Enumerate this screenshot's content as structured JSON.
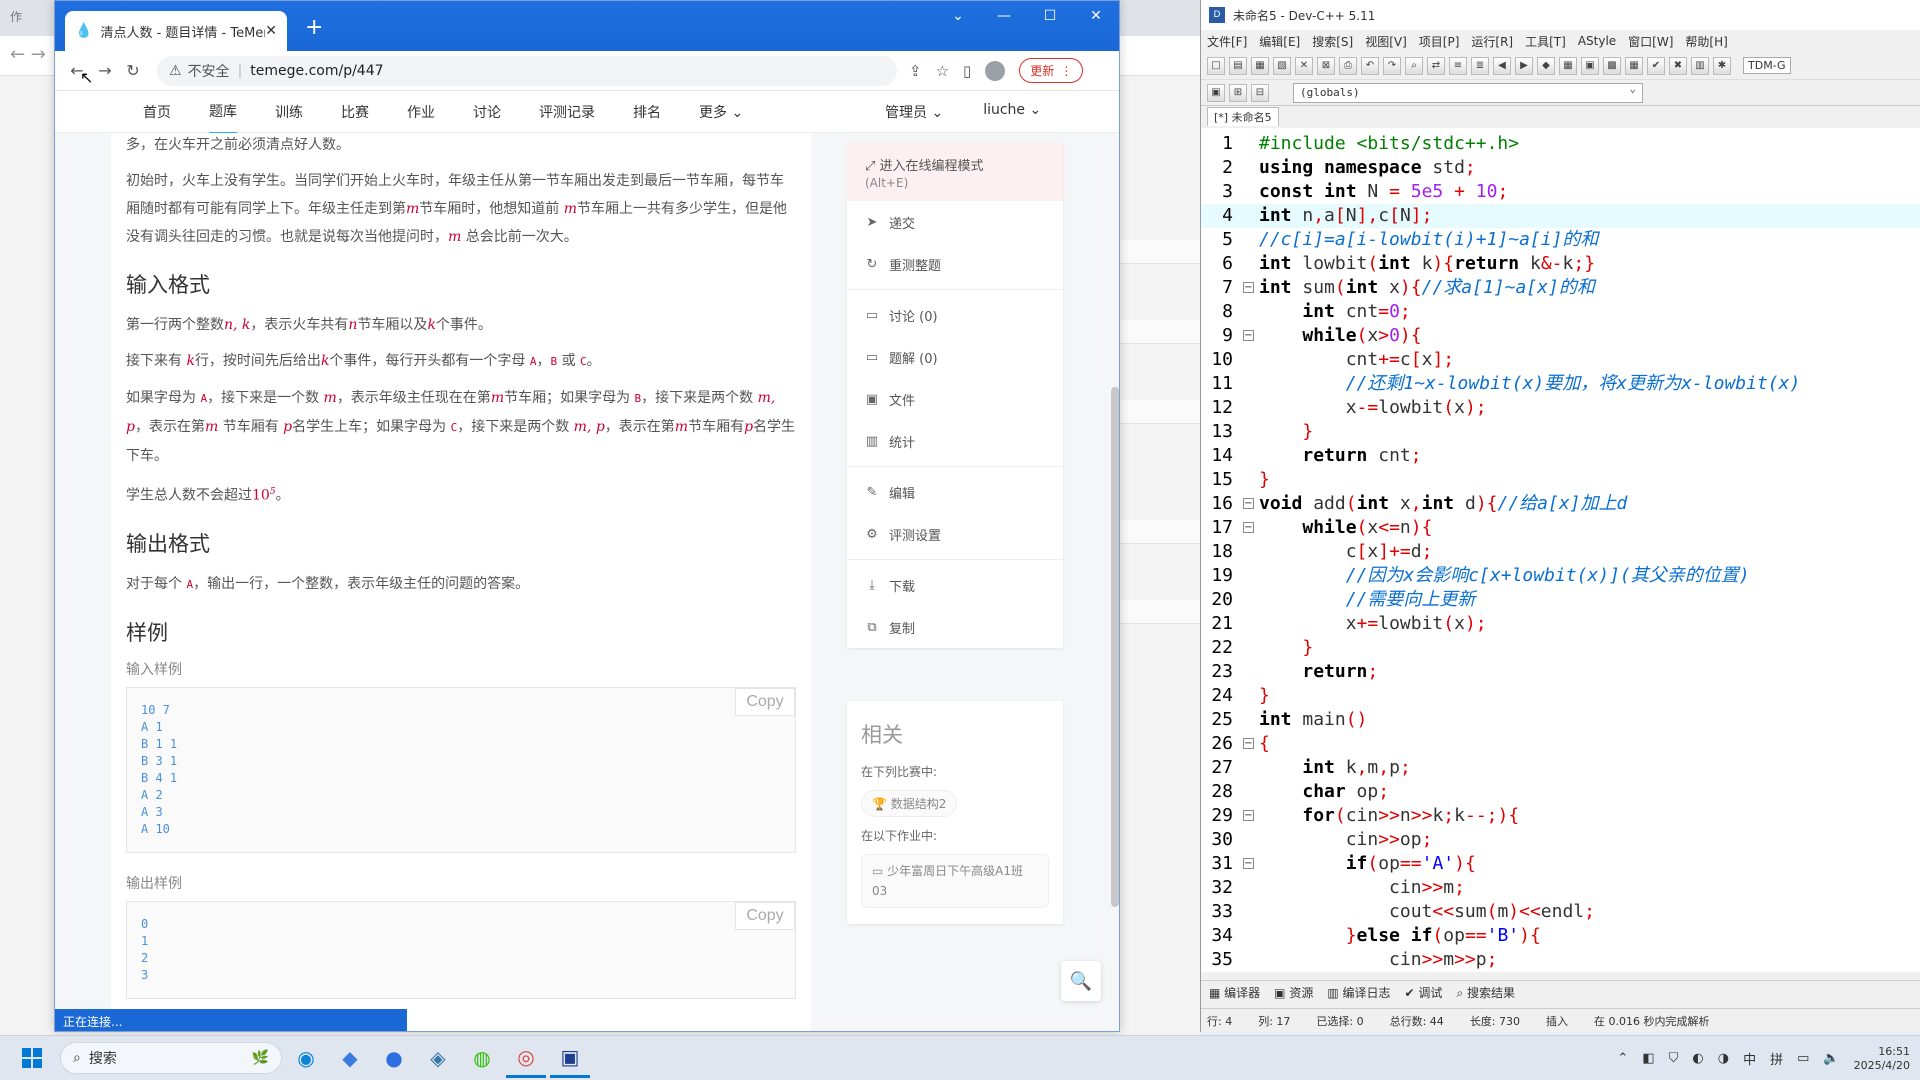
{
  "background": {
    "tab_text": "作",
    "nav_arrows": "← →"
  },
  "browser": {
    "tab_title": "清点人数 - 题目详情 - TeMenHu",
    "address": {
      "insecure_label": "不安全",
      "url": "temege.com/p/447",
      "update_label": "更新"
    },
    "site_nav": {
      "items": [
        "首页",
        "题库",
        "训练",
        "比赛",
        "作业",
        "讨论",
        "评测记录",
        "排名",
        "更多 ⌄"
      ],
      "active_index": 1,
      "admin": "管理员 ⌄",
      "user": "liuche ⌄"
    },
    "content": {
      "intro_partial": "多，在火车开之前必须清点好人数。",
      "para1_a": "初始时，火车上没有学生。当同学们开始上火车时，年级主任从第一节车厢出发走到最后一节车厢，每节车厢随时都有可能有同学上下。年级主任走到第",
      "para1_m1": "m",
      "para1_b": "节车厢时，他想知道前 ",
      "para1_m2": "m",
      "para1_c": "节车厢上一共有多少学生，但是他没有调头往回走的习惯。也就是说每次当他提问时，",
      "para1_m3": "m",
      "para1_d": " 总会比前一次大。",
      "input_heading": "输入格式",
      "in1_a": "第一行两个整数",
      "in1_nk": "n, k",
      "in1_b": "，表示火车共有",
      "in1_n": "n",
      "in1_c": "节车厢以及",
      "in1_k": "k",
      "in1_d": "个事件。",
      "in2_a": "接下来有 ",
      "in2_k": "k",
      "in2_b": "行，按时间先后给出",
      "in2_k2": "k",
      "in2_c": "个事件，每行开头都有一个字母 ",
      "tag_a": "A",
      "in2_sep1": "，",
      "tag_b": "B",
      "in2_or": " 或 ",
      "tag_c": "C",
      "in2_end": "。",
      "in3_a": "如果字母为 ",
      "in3_b": "，接下来是一个数 ",
      "in3_m": "m",
      "in3_c": "，表示年级主任现在在第",
      "in3_m2": "m",
      "in3_d": "节车厢；如果字母为 ",
      "in3_e": "，接下来是两个数 ",
      "in3_mp": "m, p",
      "in3_f": "，表示在第",
      "in3_m3": "m",
      "in3_g": " 节车厢有 ",
      "in3_p": "p",
      "in3_h": "名学生上车；如果字母为 ",
      "in3_i": "，接下来是两个数 ",
      "in3_mp2": "m, p",
      "in3_j": "，表示在第",
      "in3_m4": "m",
      "in3_k": "节车厢有",
      "in3_p2": "p",
      "in3_l": "名学生下车。",
      "in4_a": "学生总人数不会超过",
      "in4_num": "10",
      "in4_exp": "5",
      "in4_end": "。",
      "output_heading": "输出格式",
      "out1_a": "对于每个 ",
      "out1_b": "，输出一行，一个整数，表示年级主任的问题的答案。",
      "sample_heading": "样例",
      "input_sample_label": "输入样例",
      "input_sample": [
        "10 7",
        "A 1",
        "B 1 1",
        "B 3 1",
        "B 4 1",
        "A 2",
        "A 3",
        "A 10"
      ],
      "output_sample_label": "输出样例",
      "output_sample": [
        "0",
        "1",
        "2",
        "3"
      ],
      "copy_label": "Copy"
    },
    "sidebar": {
      "online_mode": "进入在线编程模式",
      "online_shortcut": "(Alt+E)",
      "actions": [
        "递交",
        "重测整题",
        "讨论 (0)",
        "题解 (0)",
        "文件",
        "统计",
        "编辑",
        "评测设置",
        "下载",
        "复制"
      ]
    },
    "related": {
      "title": "相关",
      "contest_label": "在下列比赛中:",
      "contest": "数据结构2",
      "homework_label": "在以下作业中:",
      "homework": "少年富周日下午高级A1班03"
    },
    "status_text": "正在连接..."
  },
  "devcpp": {
    "title": "未命名5 - Dev-C++ 5.11",
    "menu": [
      "文件[F]",
      "编辑[E]",
      "搜索[S]",
      "视图[V]",
      "项目[P]",
      "运行[R]",
      "工具[T]",
      "AStyle",
      "窗口[W]",
      "帮助[H]"
    ],
    "tdm": "TDM-G",
    "globals": "(globals)",
    "file_tab": "[*] 未命名5",
    "bottom_tabs": [
      "编译器",
      "资源",
      "编译日志",
      "调试",
      "搜索结果"
    ],
    "status": {
      "row": "行:  4",
      "col": "列:  17",
      "selected": "已选择:  0",
      "total": "总行数:  44",
      "length": "长度:  730",
      "mode": "插入",
      "parse": "在 0.016 秒内完成解析"
    }
  },
  "taskbar": {
    "search_label": "搜索",
    "time": "16:51",
    "date": "2025/4/20",
    "ime1": "中",
    "ime2": "拼"
  }
}
